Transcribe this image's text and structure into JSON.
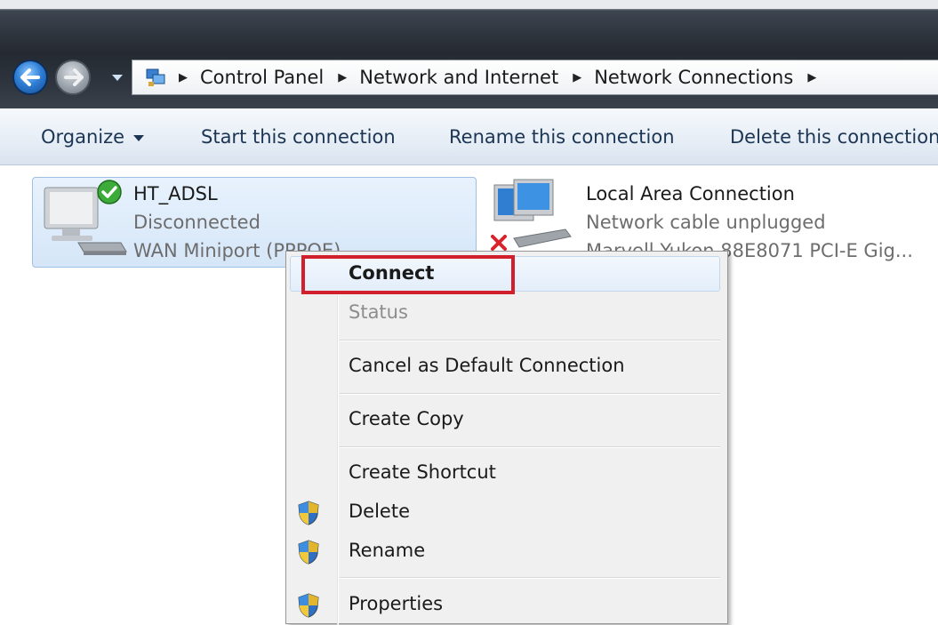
{
  "address_bar": {
    "crumbs": [
      "Control Panel",
      "Network and Internet",
      "Network Connections"
    ]
  },
  "command_bar": {
    "organize": "Organize",
    "start": "Start this connection",
    "rename": "Rename this connection",
    "delete": "Delete this connection"
  },
  "connections": [
    {
      "name": "HT_ADSL",
      "status": "Disconnected",
      "device": "WAN Miniport (PPPOE)",
      "selected": true
    },
    {
      "name": "Local Area Connection",
      "status": "Network cable unplugged",
      "device": "Marvell Yukon 88E8071 PCI-E Gig..."
    }
  ],
  "context_menu": {
    "items": [
      "Connect",
      "Status",
      "Cancel as Default Connection",
      "Create Copy",
      "Create Shortcut",
      "Delete",
      "Rename",
      "Properties"
    ],
    "highlighted": "Connect"
  },
  "colors": {
    "highlight_box": "#d11f2b",
    "selection": "#d5e6f8"
  }
}
